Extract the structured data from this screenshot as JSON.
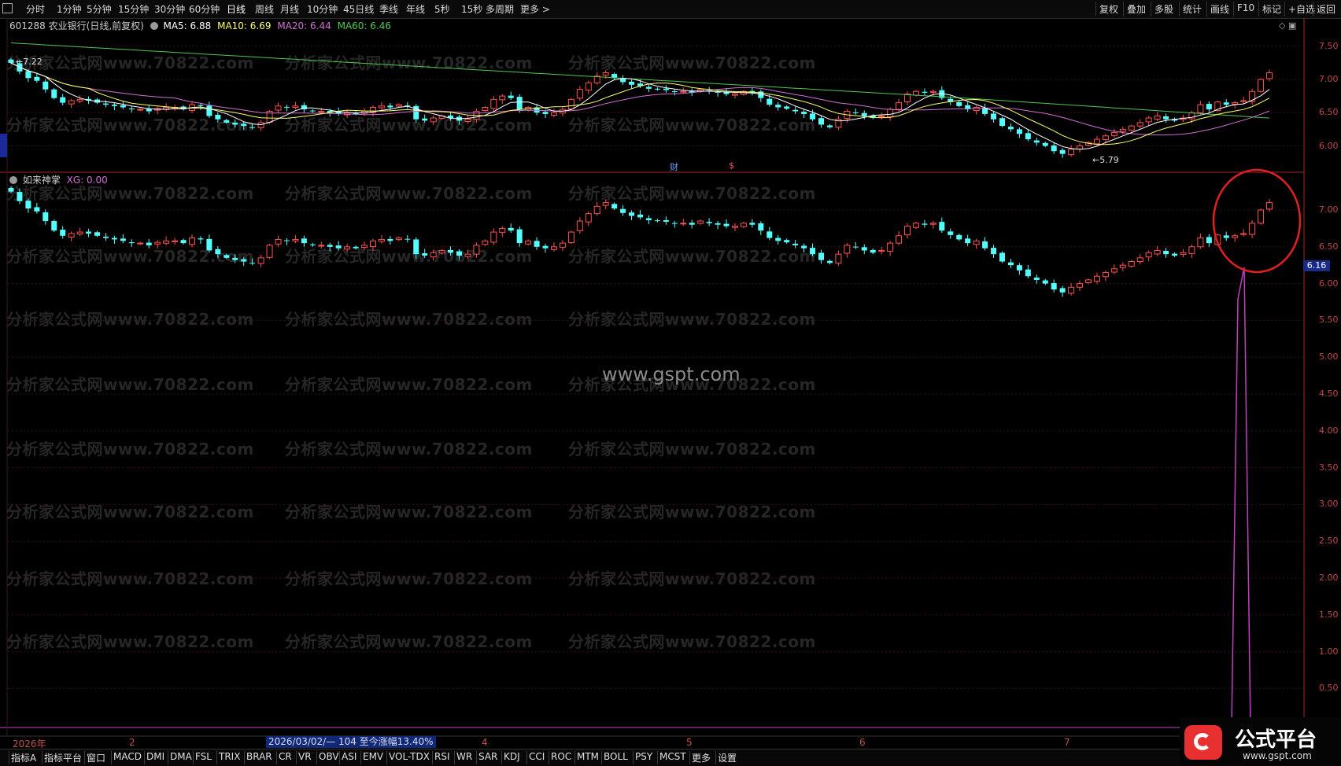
{
  "toolbar": {
    "left_items": [
      "分时",
      "1分钟",
      "5分钟",
      "15分钟",
      "30分钟",
      "60分钟",
      "日线",
      "周线",
      "月线",
      "10分钟",
      "45日线",
      "季线",
      "年线",
      "5秒",
      "15秒",
      "多周期",
      "更多 >"
    ],
    "right_items": [
      "复权",
      "叠加",
      "多股",
      "统计",
      "画线",
      "F10",
      "标记",
      "+自选",
      "返回"
    ]
  },
  "main_panel": {
    "code": "601288",
    "name": "农业银行(日线,前复权)",
    "ma5_label": "MA5: 6.88",
    "ma10_label": "MA10: 6.69",
    "ma20_label": "MA20: 6.44",
    "ma60_label": "MA60: 6.46",
    "high_marker": "7.22",
    "low_marker": "5.79",
    "event_cai": "财",
    "event_dollar": "$",
    "y_ticks": [
      "7.50",
      "7.00",
      "6.50",
      "6.00"
    ]
  },
  "indicator_panel": {
    "name": "如来神掌",
    "xg_label": "XG: 0.00",
    "y_ticks": [
      "7.00",
      "6.50",
      "6.00",
      "5.50",
      "5.00",
      "4.50",
      "4.00",
      "3.50",
      "3.00",
      "2.50",
      "2.00",
      "1.50",
      "1.00",
      "0.50"
    ],
    "current_price": "6.16"
  },
  "watermarks": {
    "text": "分析家公式网www.70822.com",
    "center": "www.gspt.com"
  },
  "date_axis": {
    "labels": [
      "2026年",
      "2",
      "4",
      "5",
      "6",
      "7"
    ],
    "range_note": "2026/03/02/— 104 至今涨幅13.40%"
  },
  "bottom_tabs": [
    "指标A",
    "指标平台",
    "窗口",
    "MACD",
    "DMI",
    "DMA",
    "FSL",
    "TRIX",
    "BRAR",
    "CR",
    "VR",
    "OBV",
    "ASI",
    "EMV",
    "VOL-TDX",
    "RSI",
    "WR",
    "SAR",
    "KDJ",
    "CCI",
    "ROC",
    "MTM",
    "BOLL",
    "PSY",
    "MCST",
    "更多",
    "设置"
  ],
  "logo": {
    "title": "公式平台",
    "url": "www.gspt.com"
  },
  "colors": {
    "up": "#ff5050",
    "down": "#54ffff",
    "ma5": "#ffffff",
    "ma10": "#ffff66",
    "ma20": "#d070d0",
    "ma60": "#50c850",
    "axis": "#a02828",
    "signal": "#c040c0",
    "circle": "#e02020"
  },
  "chart_data": {
    "type": "candlestick",
    "series": "601288 农业银行 daily OHLC (approx.)",
    "close": [
      7.25,
      7.12,
      7.02,
      6.98,
      6.85,
      6.72,
      6.65,
      6.68,
      6.7,
      6.68,
      6.65,
      6.62,
      6.6,
      6.58,
      6.55,
      6.55,
      6.52,
      6.56,
      6.58,
      6.58,
      6.55,
      6.62,
      6.6,
      6.45,
      6.4,
      6.35,
      6.32,
      6.3,
      6.28,
      6.35,
      6.52,
      6.6,
      6.58,
      6.6,
      6.55,
      6.52,
      6.52,
      6.5,
      6.48,
      6.5,
      6.48,
      6.52,
      6.58,
      6.6,
      6.58,
      6.62,
      6.6,
      6.4,
      6.38,
      6.42,
      6.45,
      6.42,
      6.38,
      6.4,
      6.52,
      6.58,
      6.7,
      6.75,
      6.72,
      6.55,
      6.58,
      6.5,
      6.48,
      6.5,
      6.55,
      6.7,
      6.85,
      6.95,
      7.05,
      7.1,
      7.02,
      6.96,
      6.92,
      6.9,
      6.86,
      6.85,
      6.84,
      6.82,
      6.82,
      6.8,
      6.85,
      6.82,
      6.8,
      6.78,
      6.78,
      6.82,
      6.8,
      6.72,
      6.62,
      6.58,
      6.56,
      6.52,
      6.48,
      6.4,
      6.32,
      6.28,
      6.4,
      6.52,
      6.5,
      6.45,
      6.42,
      6.45,
      6.55,
      6.65,
      6.78,
      6.82,
      6.8,
      6.82,
      6.72,
      6.66,
      6.6,
      6.55,
      6.58,
      6.48,
      6.4,
      6.3,
      6.25,
      6.18,
      6.1,
      6.05,
      6.0,
      5.92,
      5.88,
      5.95,
      6.0,
      6.05,
      6.1,
      6.15,
      6.2,
      6.25,
      6.3,
      6.35,
      6.42,
      6.45,
      6.4,
      6.38,
      6.42,
      6.5,
      6.62,
      6.55,
      6.66,
      6.62,
      6.65,
      6.68,
      6.82,
      7.0,
      7.1
    ]
  }
}
